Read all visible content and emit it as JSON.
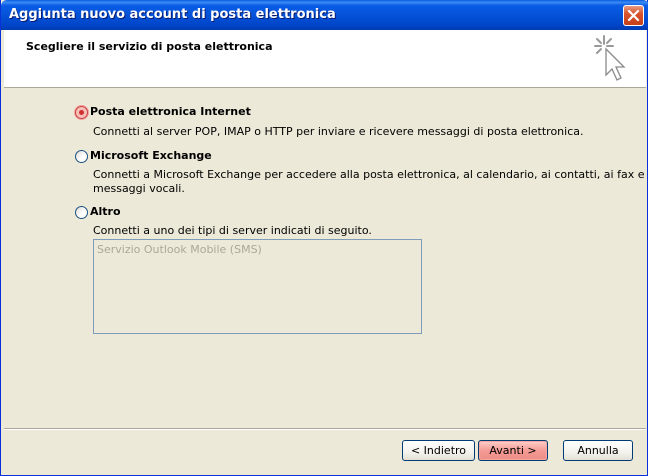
{
  "window": {
    "title": "Aggiunta nuovo account di posta elettronica"
  },
  "header": {
    "heading": "Scegliere il servizio di posta elettronica"
  },
  "options": [
    {
      "label": "Posta elettronica Internet",
      "description": [
        "Connetti al server POP, IMAP o HTTP per inviare e ricevere messaggi di posta elettronica."
      ],
      "selected": true
    },
    {
      "label": "Microsoft Exchange",
      "description": [
        "Connetti a Microsoft Exchange per accedere alla posta elettronica, al calendario, ai contatti, ai fax e ai",
        "messaggi vocali."
      ],
      "selected": false
    },
    {
      "label": "Altro",
      "description": [
        "Connetti a uno dei tipi di server indicati di seguito."
      ],
      "selected": false
    }
  ],
  "server_list": {
    "items": [
      "Servizio Outlook Mobile (SMS)"
    ]
  },
  "buttons": {
    "back": "< Indietro",
    "next": "Avanti >",
    "cancel": "Annulla"
  },
  "colors": {
    "titlebar": "#0453d8",
    "dialog_bg": "#ece9d8",
    "default_button": "#f49b95"
  },
  "icons": {
    "close": "close-icon",
    "wizard": "sparkle-cursor-icon"
  }
}
